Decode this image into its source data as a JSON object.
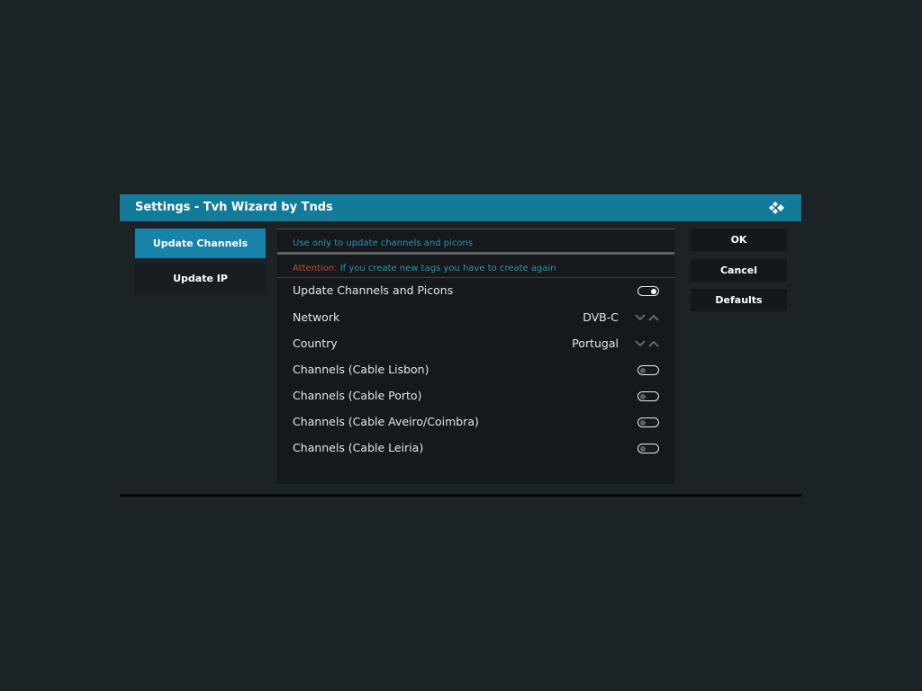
{
  "dialog": {
    "title": "Settings - Tvh Wizard by Tnds",
    "icon": "kodi-logo-icon"
  },
  "categories": [
    {
      "label": "Update Channels",
      "active": true
    },
    {
      "label": "Update IP",
      "active": false
    }
  ],
  "panel": {
    "description": "Use only to update channels and picons",
    "attention_label": "Attention:",
    "attention_text": " If you create new tags you have to create again",
    "settings": [
      {
        "label": "Update Channels and Picons",
        "type": "toggle",
        "enabled": true
      },
      {
        "label": "Network",
        "type": "spinner",
        "value": "DVB-C"
      },
      {
        "label": "Country",
        "type": "spinner",
        "value": "Portugal"
      },
      {
        "label": "Channels (Cable Lisbon)",
        "type": "toggle",
        "enabled": false
      },
      {
        "label": "Channels (Cable Porto)",
        "type": "toggle",
        "enabled": false
      },
      {
        "label": "Channels (Cable Aveiro/Coimbra)",
        "type": "toggle",
        "enabled": false
      },
      {
        "label": "Channels (Cable Leiria)",
        "type": "toggle",
        "enabled": false
      }
    ]
  },
  "buttons": {
    "ok": "OK",
    "cancel": "Cancel",
    "defaults": "Defaults"
  },
  "colors": {
    "background": "#1b2326",
    "header": "#147a99",
    "active_category": "#1783a8",
    "info_text": "#2c93b8",
    "attention": "#c04d2e"
  }
}
